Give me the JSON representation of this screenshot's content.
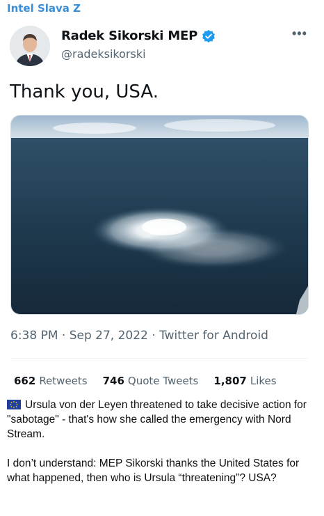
{
  "channel": {
    "name": "Intel Slava Z"
  },
  "tweet": {
    "author_name": "Radek Sikorski MEP",
    "author_handle": "@radeksikorski",
    "more_label": "•••",
    "text": "Thank you, USA.",
    "time": "6:38 PM · Sep 27, 2022 · Twitter for Android",
    "stats": {
      "retweets_count": "662",
      "retweets_label": "Retweets",
      "quotes_count": "746",
      "quotes_label": "Quote Tweets",
      "likes_count": "1,807",
      "likes_label": "Likes"
    }
  },
  "caption": {
    "paragraph1": "Ursula von der Leyen threatened to take decisive action for \"sabotage\" - that's how she called the emergency with Nord Stream.",
    "paragraph2": "I don’t understand: MEP Sikorski thanks the United States for what happened, then who is Ursula “threatening”? USA?"
  },
  "colors": {
    "channel": "#3a8fd6",
    "verified": "#1d9bf0",
    "sea": "#1f3a4f",
    "secondary_text": "#536471"
  }
}
